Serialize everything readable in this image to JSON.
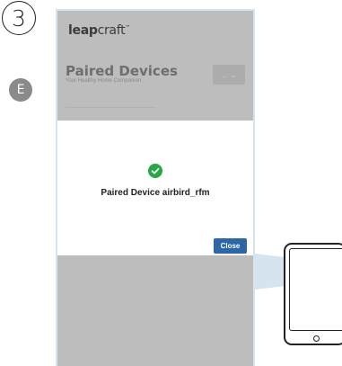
{
  "step": {
    "number": "3",
    "marker": "E"
  },
  "app": {
    "logo_bold": "leap",
    "logo_light": "craft",
    "logo_tm": "™",
    "page_title": "Paired Devices",
    "page_subtitle": "Your Healthy Home Companion",
    "dropdown_label": "...",
    "dropdown_chevron": "⌄"
  },
  "modal": {
    "icon": "check-circle-icon",
    "message": "Paired Device airbird_rfm",
    "close_label": "Close"
  },
  "colors": {
    "success": "#27a845",
    "button": "#2a66a8",
    "overlay": "#bdbdbd",
    "frame": "#d6e4ef"
  }
}
